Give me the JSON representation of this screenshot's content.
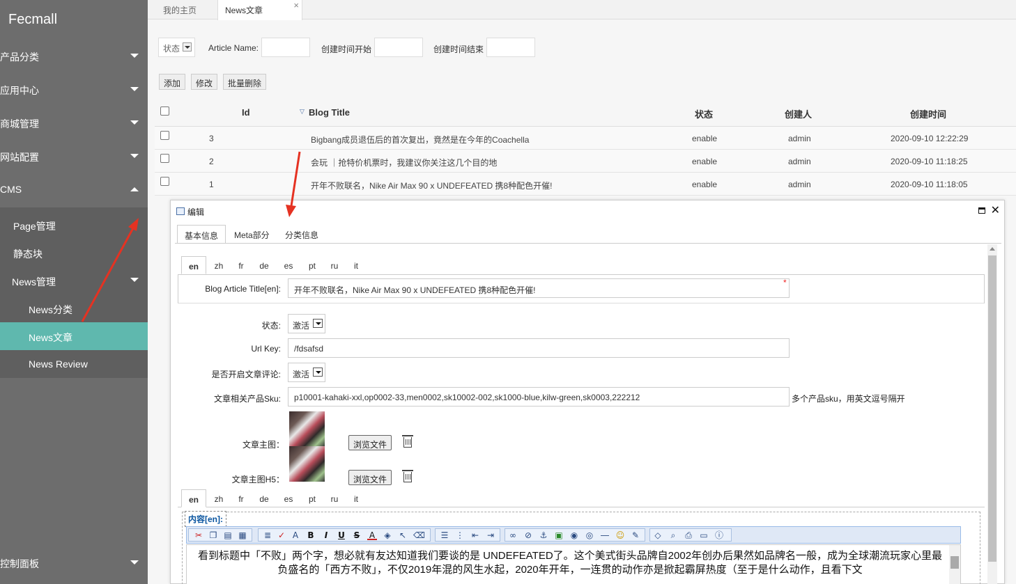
{
  "brand": "Fecmall",
  "sidebar": {
    "items": [
      {
        "label": "产品分类"
      },
      {
        "label": "应用中心"
      },
      {
        "label": "商城管理"
      },
      {
        "label": "网站配置"
      },
      {
        "label": "CMS"
      }
    ],
    "sub_items": [
      {
        "label": "Page管理"
      },
      {
        "label": "静态块"
      },
      {
        "label": "News管理"
      },
      {
        "label": "News分类"
      },
      {
        "label": "News文章"
      },
      {
        "label": "News Review"
      }
    ],
    "bottom_item": {
      "label": "控制面板"
    }
  },
  "top_tabs": [
    {
      "label": "我的主页"
    },
    {
      "label": "News文章",
      "close": "×"
    }
  ],
  "search": {
    "status_label": "状态",
    "article_name_label": "Article Name:",
    "created_start_label": "创建时间开始",
    "created_end_label": "创建时间结束"
  },
  "actions": {
    "add": "添加",
    "edit": "修改",
    "batch_delete": "批量删除"
  },
  "table": {
    "columns": [
      "Id",
      "Blog Title",
      "状态",
      "创建人",
      "创建时间"
    ],
    "rows": [
      {
        "id": "3",
        "title": "Bigbang成员退伍后的首次复出，竟然是在今年的Coachella",
        "status": "enable",
        "creator": "admin",
        "created": "2020-09-10 12:22:29"
      },
      {
        "id": "2",
        "title": "会玩 ｜抢特价机票时，我建议你关注这几个目的地",
        "status": "enable",
        "creator": "admin",
        "created": "2020-09-10 11:18:25"
      },
      {
        "id": "1",
        "title": "开年不败联名，Nike Air Max 90 x UNDEFEATED 携8种配色开催!",
        "status": "enable",
        "creator": "admin",
        "created": "2020-09-10 11:18:05"
      }
    ]
  },
  "dialog": {
    "title": "编辑",
    "tabs": [
      "基本信息",
      "Meta部分",
      "分类信息"
    ],
    "langs": [
      "en",
      "zh",
      "fr",
      "de",
      "es",
      "pt",
      "ru",
      "it"
    ],
    "fields": {
      "title_label": "Blog Article Title[en]:",
      "title_value": "开年不败联名，Nike Air Max 90 x UNDEFEATED 携8种配色开催!",
      "required_mark": "*",
      "status_label": "状态:",
      "status_value": "激活",
      "urlkey_label": "Url Key:",
      "urlkey_value": "/fdsafsd",
      "comment_label": "是否开启文章评论:",
      "comment_value": "激活",
      "sku_label": "文章相关产品Sku:",
      "sku_value": "p10001-kahaki-xxl,op0002-33,men0002,sk10002-002,sk1000-blue,kilw-green,sk0003,222212",
      "sku_hint": "多个产品sku，用英文逗号隔开",
      "image_label": "文章主图：",
      "image_h5_label": "文章主图H5：",
      "browse_label": "浏览文件"
    },
    "content_label": "内容[en]:",
    "content_text": "看到标题中「不败」两个字，想必就有友达知道我们要谈的是 UNDEFEATED了。这个美式街头品牌自2002年创办后果然如品牌名一般，成为全球潮流玩家心里最负盛名的「西方不败」，不仅2019年混的风生水起，2020年开年，一连贯的动作亦是掀起霸屏热度（至于是什么动作，且看下文"
  },
  "colors": {
    "sidebar": "#6d6d6d",
    "active": "#5fb8ae",
    "arrow": "#e53222"
  }
}
